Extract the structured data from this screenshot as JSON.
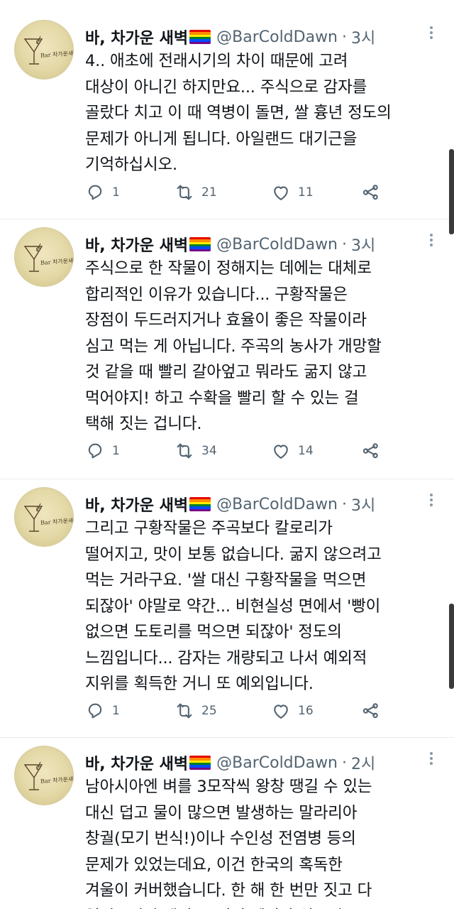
{
  "author": {
    "name": "바, 차가운 새벽",
    "handle": "@BarColdDawn",
    "avatar_text": "Bar 차가운새벽"
  },
  "colors": {
    "flag": [
      "#e40303",
      "#ff8c00",
      "#ffed00",
      "#008026",
      "#004dff",
      "#750787"
    ],
    "muted": "#536471",
    "text": "#0f1419"
  },
  "tweets": [
    {
      "time": "3시",
      "lines": [
        "4.. 애초에 전래시기의 차이 때문에 고려",
        "대상이 아니긴 하지만요... 주식으로 감자를",
        "골랐다 치고 이 때 역병이 돌면, 쌀 흉년 정도의",
        "문제가 아니게 됩니다. 아일랜드 대기근을",
        "기억하십시오."
      ],
      "replies": "1",
      "retweets": "21",
      "likes": "11"
    },
    {
      "time": "3시",
      "lines": [
        "주식으로 한 작물이 정해지는 데에는 대체로",
        "합리적인 이유가 있습니다... 구황작물은",
        "장점이 두드러지거나 효율이 좋은 작물이라",
        "심고 먹는 게 아닙니다. 주곡의 농사가 개망할",
        "것 같을 때 빨리 갈아엎고 뭐라도 굶지 않고",
        "먹어야지! 하고 수확을 빨리 할 수 있는 걸",
        "택해 짓는 겁니다."
      ],
      "replies": "1",
      "retweets": "34",
      "likes": "14"
    },
    {
      "time": "3시",
      "lines": [
        "그리고 구황작물은 주곡보다 칼로리가",
        "떨어지고, 맛이 보통 없습니다. 굶지 않으려고",
        "먹는 거라구요. '쌀 대신 구황작물을 먹으면",
        "되잖아' 야말로 약간... 비현실성 면에서 '빵이",
        "없으면 도토리를 먹으면 되잖아' 정도의",
        "느낌입니다... 감자는 개량되고 나서 예외적",
        "지위를 획득한 거니 또 예외입니다."
      ],
      "replies": "1",
      "retweets": "25",
      "likes": "16"
    },
    {
      "time": "2시",
      "lines": [
        "남아시아엔 벼를 3모작씩 왕창 땡길 수 있는",
        "대신 덥고 물이 많으면 발생하는 말라리아",
        "창궐(모기 번식!)이나 수인성 전염병 등의",
        "문제가 있었는데요, 이건 한국의 혹독한",
        "겨울이 커버했습니다. 한 해 한 번만 짓고 다",
        "얼려죽이면 됐지요. 진렬 빼지만 심으면"
      ]
    }
  ]
}
